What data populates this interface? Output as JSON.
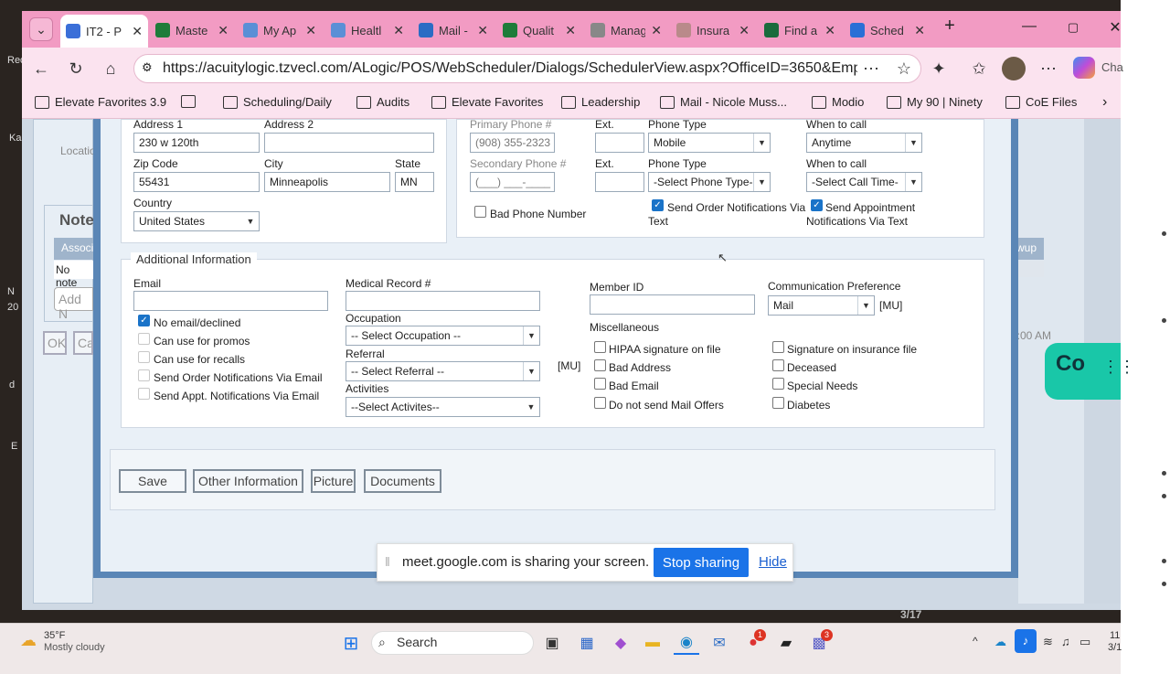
{
  "browser": {
    "tabs": [
      {
        "label": "IT2 - P",
        "active": true,
        "color": "#3b6fd8"
      },
      {
        "label": "Maste",
        "color": "#1e7c3a"
      },
      {
        "label": "My Ap",
        "color": "#5b8fd6"
      },
      {
        "label": "Healtl",
        "color": "#5b8fd6"
      },
      {
        "label": "Mail -",
        "color": "#2b6cc4"
      },
      {
        "label": "Qualit",
        "color": "#1e7c3a"
      },
      {
        "label": "Manag",
        "color": "#888888"
      },
      {
        "label": "Insura",
        "color": "#b98a8a"
      },
      {
        "label": "Find a",
        "color": "#1a6b3c"
      },
      {
        "label": "Sched",
        "color": "#2a6fd6"
      }
    ],
    "url": "https://acuitylogic.tzvecl.com/ALogic/POS/WebScheduler/Dialogs/SchedulerView.aspx?OfficeID=3650&Employe...",
    "copilot_label": "Cha",
    "favorites": [
      {
        "label": "Elevate Favorites 3.9"
      },
      {
        "label": ""
      },
      {
        "label": "Scheduling/Daily"
      },
      {
        "label": "Audits"
      },
      {
        "label": "Elevate Favorites"
      },
      {
        "label": "Leadership"
      },
      {
        "label": "Mail - Nicole Muss..."
      },
      {
        "label": "Modio"
      },
      {
        "label": "My 90 | Ninety"
      },
      {
        "label": "CoE Files"
      }
    ]
  },
  "left_panel": {
    "location_label": "Locatio",
    "notes_title": "Note",
    "assoc_header": "Associ",
    "no_notes": "No note",
    "add_note": "Add N",
    "ok": "OK",
    "cancel": "Car"
  },
  "right_panel": {
    "wup_header": "wup",
    "time_text": "5:00 AM"
  },
  "address": {
    "address1_label": "Address 1",
    "address1_value": "230 w 120th",
    "address2_label": "Address 2",
    "address2_value": "",
    "zip_label": "Zip Code",
    "zip_value": "55431",
    "city_label": "City",
    "city_value": "Minneapolis",
    "state_label": "State",
    "state_value": "MN",
    "country_label": "Country",
    "country_value": "United States"
  },
  "phone": {
    "primary_label": "Primary Phone #",
    "primary_value": "(908) 355-2323",
    "ext1_label": "Ext.",
    "type1_label": "Phone Type",
    "type1_value": "Mobile",
    "when1_label": "When to call",
    "when1_value": "Anytime",
    "secondary_label": "Secondary Phone #",
    "secondary_placeholder": "(___) ___-____",
    "ext2_label": "Ext.",
    "type2_label": "Phone Type",
    "type2_value": "-Select Phone Type-",
    "when2_label": "When to call",
    "when2_value": "-Select Call Time-",
    "bad_phone": "Bad Phone Number",
    "send_order_text_1": "Send Order Notifications Via",
    "send_order_text_2": "Text",
    "send_appt_text_1": "Send Appointment",
    "send_appt_text_2": "Notifications Via Text"
  },
  "additional": {
    "legend": "Additional Information",
    "email_label": "Email",
    "email_value": "",
    "no_email": "No email/declined",
    "promos": "Can use for promos",
    "recalls": "Can use for recalls",
    "order_email": "Send Order Notifications Via Email",
    "appt_email": "Send Appt. Notifications Via Email",
    "mrn_label": "Medical Record #",
    "mrn_value": "",
    "occupation_label": "Occupation",
    "occupation_value": "-- Select Occupation --",
    "referral_label": "Referral",
    "referral_value": "-- Select Referral --",
    "mu_referral": "[MU]",
    "activities_label": "Activities",
    "activities_value": "--Select Activites--",
    "member_label": "Member ID",
    "member_value": "",
    "comm_label": "Communication Preference",
    "comm_value": "Mail",
    "mu_comm": "[MU]",
    "misc_label": "Miscellaneous",
    "hipaa": "HIPAA signature on file",
    "bad_address": "Bad Address",
    "bad_email": "Bad Email",
    "no_mail": "Do not send Mail Offers",
    "sig_ins": "Signature on insurance file",
    "deceased": "Deceased",
    "special": "Special Needs",
    "diabetes": "Diabetes"
  },
  "buttons": {
    "save": "Save",
    "other": "Other Information",
    "picture": "Picture",
    "documents": "Documents"
  },
  "share_bar": {
    "message": "meet.google.com is sharing your screen.",
    "stop": "Stop sharing",
    "hide": "Hide"
  },
  "overlay": {
    "copilot_badge": "Co"
  },
  "taskbar": {
    "temp": "35°F",
    "weather": "Mostly cloudy",
    "search": "Search",
    "chrome_badge": "1",
    "teams_badge": "3",
    "clock_1": "11",
    "clock_2": "3/1",
    "page_counter": "3/17"
  },
  "desktop": {
    "rec": "Rec",
    "ka": "Ka",
    "n": "N",
    "y": "20",
    "d": "d",
    "e": "E"
  }
}
